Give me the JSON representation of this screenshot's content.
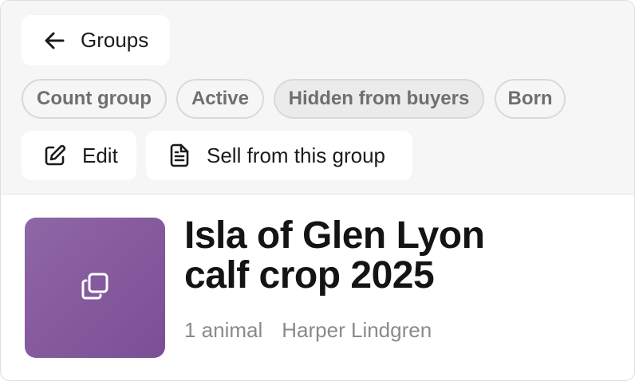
{
  "header": {
    "back_label": "Groups",
    "back_icon": "arrow-left-icon"
  },
  "tags": [
    {
      "label": "Count group"
    },
    {
      "label": "Active"
    },
    {
      "label": "Hidden from buyers"
    },
    {
      "label": "Born"
    }
  ],
  "actions": {
    "edit_label": "Edit",
    "edit_icon": "pencil-edit-icon",
    "sell_label": "Sell from this group",
    "sell_icon": "document-icon"
  },
  "group": {
    "title_line1": "Isla of Glen Lyon",
    "title_line2": "calf crop 2025",
    "count": "1 animal",
    "owner": "Harper Lindgren",
    "thumb_icon": "copy-stack-icon",
    "thumb_color": "#8a5fa3"
  }
}
